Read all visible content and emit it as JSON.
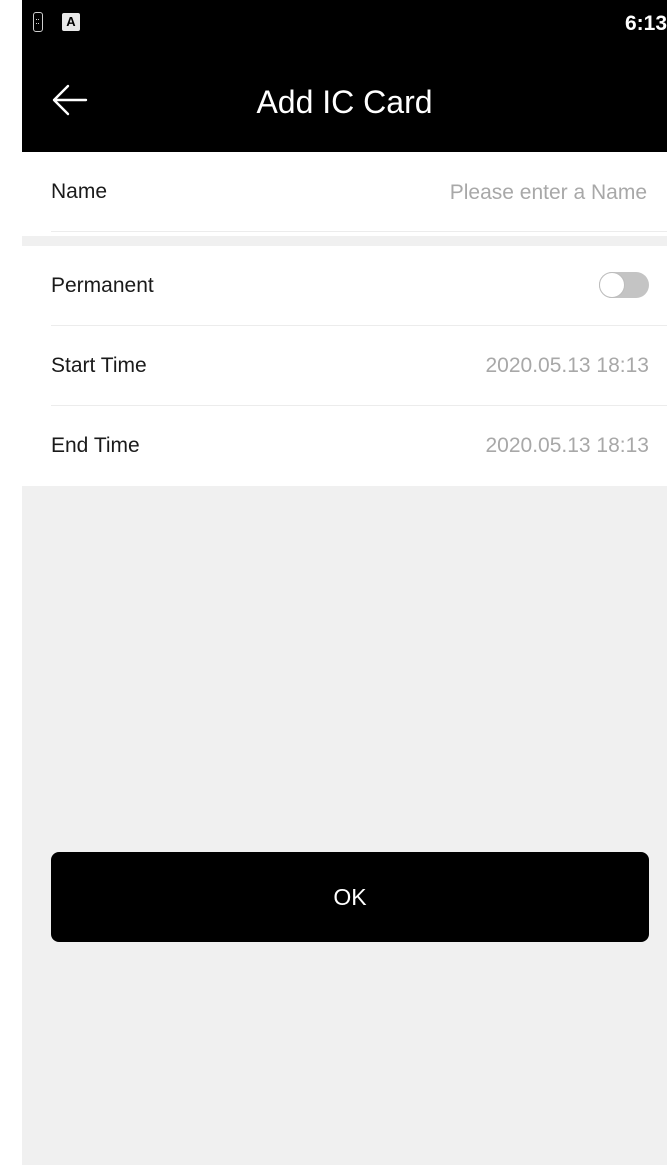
{
  "status_bar": {
    "time": "6:13",
    "notification_icon_letter": "A"
  },
  "header": {
    "title": "Add IC Card",
    "back_icon": "arrow-left-icon"
  },
  "form": {
    "name": {
      "label": "Name",
      "value": "",
      "placeholder": "Please enter a Name"
    },
    "permanent": {
      "label": "Permanent",
      "enabled": false
    },
    "start_time": {
      "label": "Start Time",
      "value": "2020.05.13 18:13"
    },
    "end_time": {
      "label": "End Time",
      "value": "2020.05.13 18:13"
    }
  },
  "actions": {
    "ok_label": "OK"
  },
  "colors": {
    "bar": "#000000",
    "background": "#f0f0f0",
    "secondary_text": "#a8a8a8",
    "toggle_off": "#c4c4c4"
  }
}
